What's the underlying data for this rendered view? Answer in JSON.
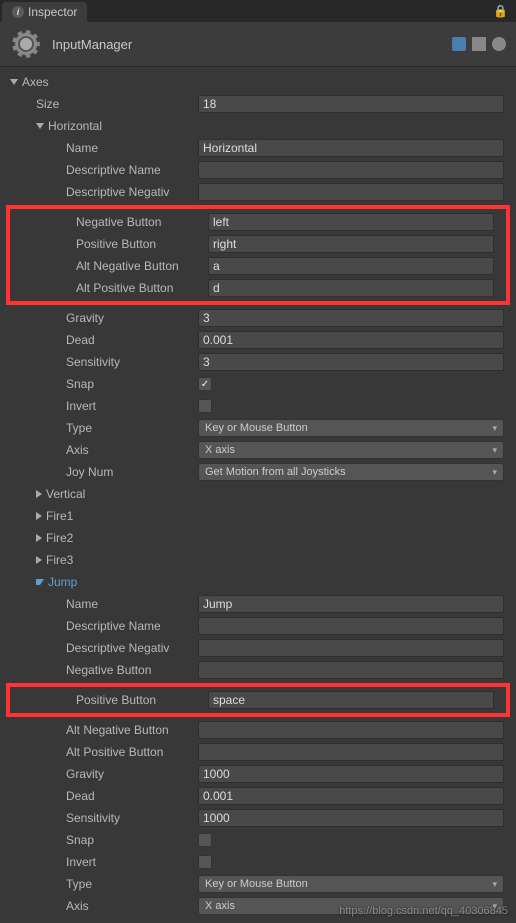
{
  "tab": {
    "label": "Inspector"
  },
  "header": {
    "title": "InputManager"
  },
  "axes": {
    "label": "Axes",
    "size_label": "Size",
    "size_value": "18",
    "horizontal": {
      "label": "Horizontal",
      "name_label": "Name",
      "name_value": "Horizontal",
      "desc_name_label": "Descriptive Name",
      "desc_name_value": "",
      "desc_neg_label": "Descriptive Negativ",
      "desc_neg_value": "",
      "neg_btn_label": "Negative Button",
      "neg_btn_value": "left",
      "pos_btn_label": "Positive Button",
      "pos_btn_value": "right",
      "alt_neg_label": "Alt Negative Button",
      "alt_neg_value": "a",
      "alt_pos_label": "Alt Positive Button",
      "alt_pos_value": "d",
      "gravity_label": "Gravity",
      "gravity_value": "3",
      "dead_label": "Dead",
      "dead_value": "0.001",
      "sens_label": "Sensitivity",
      "sens_value": "3",
      "snap_label": "Snap",
      "snap_checked": true,
      "invert_label": "Invert",
      "invert_checked": false,
      "type_label": "Type",
      "type_value": "Key or Mouse Button",
      "axis_label": "Axis",
      "axis_value": "X axis",
      "joy_label": "Joy Num",
      "joy_value": "Get Motion from all Joysticks"
    },
    "collapsed": [
      "Vertical",
      "Fire1",
      "Fire2",
      "Fire3"
    ],
    "jump": {
      "label": "Jump",
      "name_label": "Name",
      "name_value": "Jump",
      "desc_name_label": "Descriptive Name",
      "desc_name_value": "",
      "desc_neg_label": "Descriptive Negativ",
      "desc_neg_value": "",
      "neg_btn_label": "Negative Button",
      "neg_btn_value": "",
      "pos_btn_label": "Positive Button",
      "pos_btn_value": "space",
      "alt_neg_label": "Alt Negative Button",
      "alt_neg_value": "",
      "alt_pos_label": "Alt Positive Button",
      "alt_pos_value": "",
      "gravity_label": "Gravity",
      "gravity_value": "1000",
      "dead_label": "Dead",
      "dead_value": "0.001",
      "sens_label": "Sensitivity",
      "sens_value": "1000",
      "snap_label": "Snap",
      "snap_checked": false,
      "invert_label": "Invert",
      "invert_checked": false,
      "type_label": "Type",
      "type_value": "Key or Mouse Button",
      "axis_label": "Axis",
      "axis_value": "X axis"
    }
  },
  "watermark": "https://blog.csdn.net/qq_40306845"
}
